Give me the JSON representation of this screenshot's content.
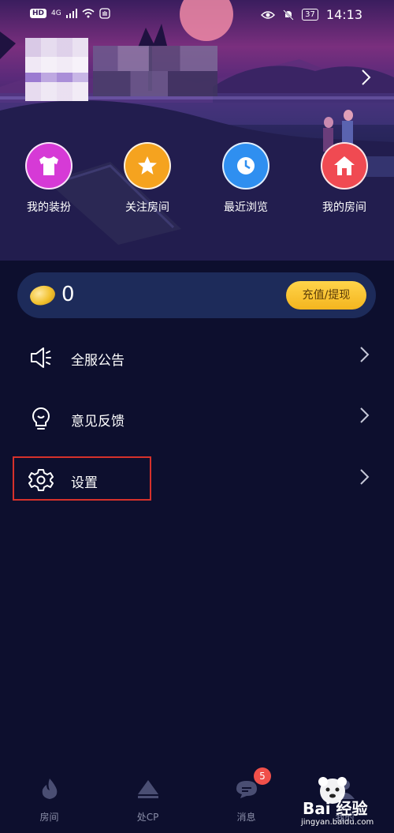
{
  "status_bar": {
    "hd": "HD",
    "network": "4G",
    "battery": "37",
    "time": "14:13"
  },
  "quick_actions": [
    {
      "label": "我的装扮",
      "icon": "shirt-icon",
      "color": "#d63ad6"
    },
    {
      "label": "关注房间",
      "icon": "star-icon",
      "color": "#f5a31f"
    },
    {
      "label": "最近浏览",
      "icon": "clock-icon",
      "color": "#2f8ff0"
    },
    {
      "label": "我的房间",
      "icon": "house-icon",
      "color": "#f04a52"
    }
  ],
  "wallet": {
    "balance": "0",
    "recharge_label": "充值/提现"
  },
  "menu": [
    {
      "label": "全服公告",
      "icon": "megaphone-icon"
    },
    {
      "label": "意见反馈",
      "icon": "lightbulb-icon"
    },
    {
      "label": "设置",
      "icon": "gear-icon"
    }
  ],
  "bottom_nav": [
    {
      "label": "房间",
      "icon": "flame-icon"
    },
    {
      "label": "处CP",
      "icon": "pyramid-icon"
    },
    {
      "label": "消息",
      "icon": "chat-icon",
      "badge": "5"
    },
    {
      "label": "我的",
      "icon": "profile-icon"
    }
  ],
  "watermark": {
    "text": "Bai 经验",
    "url": "jingyan.baidu.com"
  },
  "colors": {
    "background": "#0d0f2e",
    "accent_gold": "#f4b51f",
    "highlight_red": "#d6312b",
    "badge_red": "#f0504a"
  }
}
